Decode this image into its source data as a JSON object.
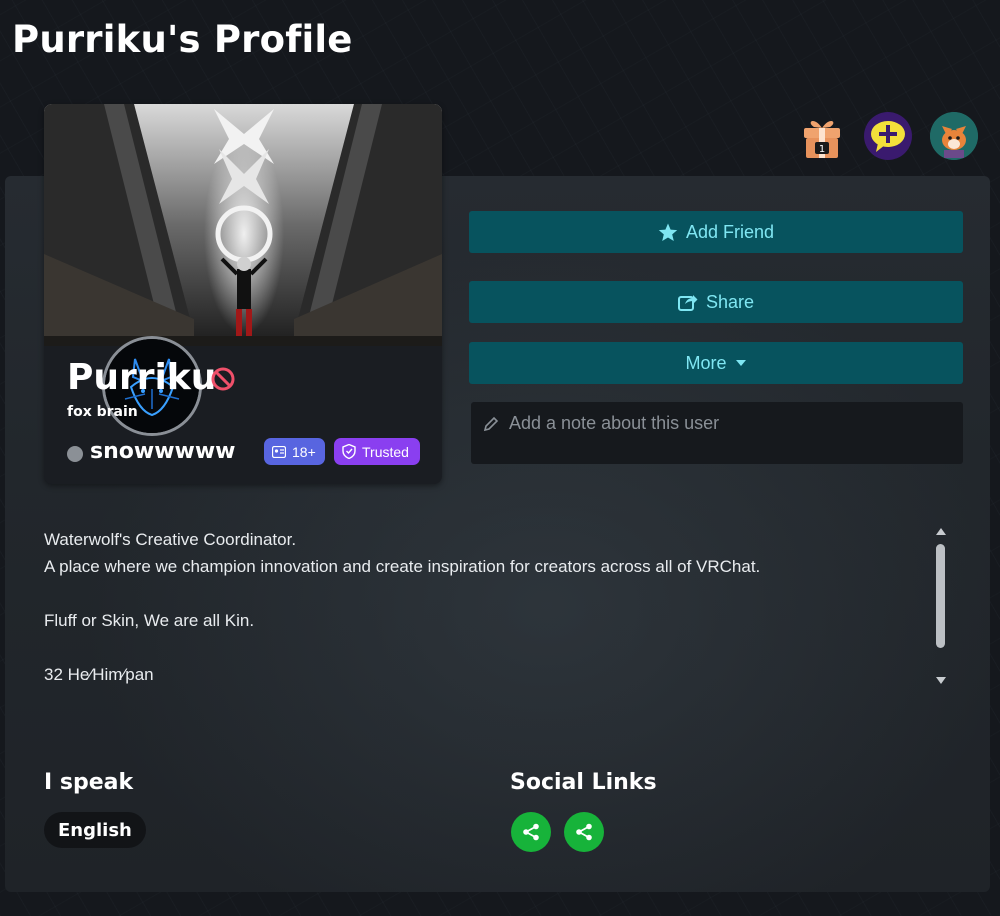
{
  "page": {
    "title": "Purriku's Profile"
  },
  "top_icons": [
    {
      "name": "gift-icon",
      "badge": "1"
    },
    {
      "name": "add-comment-icon"
    },
    {
      "name": "fox-avatar-icon"
    }
  ],
  "profile": {
    "display_name": "Purriku",
    "pronouns": "fox brain",
    "status": "snowwwww",
    "status_color": "#8b9096",
    "badges": {
      "age": "18+",
      "trust": "Trusted"
    },
    "blocked_icon": "block-icon"
  },
  "actions": {
    "add_friend": "Add Friend",
    "share": "Share",
    "more": "More",
    "note_placeholder": "Add a note about this user"
  },
  "bio": [
    "Waterwolf's Creative Coordinator.",
    "A place where we champion innovation and create inspiration for creators across all of VRChat.",
    "",
    "Fluff or Skin, We are all Kin.",
    "",
    "32 He⁄Him⁄pan"
  ],
  "languages": {
    "title": "I speak",
    "items": [
      "English"
    ]
  },
  "social": {
    "title": "Social Links",
    "count": 2
  },
  "colors": {
    "accent_button": "#07535e",
    "accent_text": "#7fe6f2",
    "badge_age": "#5865e0",
    "badge_trusted": "#8a3ff0",
    "social_green": "#17b33a"
  }
}
